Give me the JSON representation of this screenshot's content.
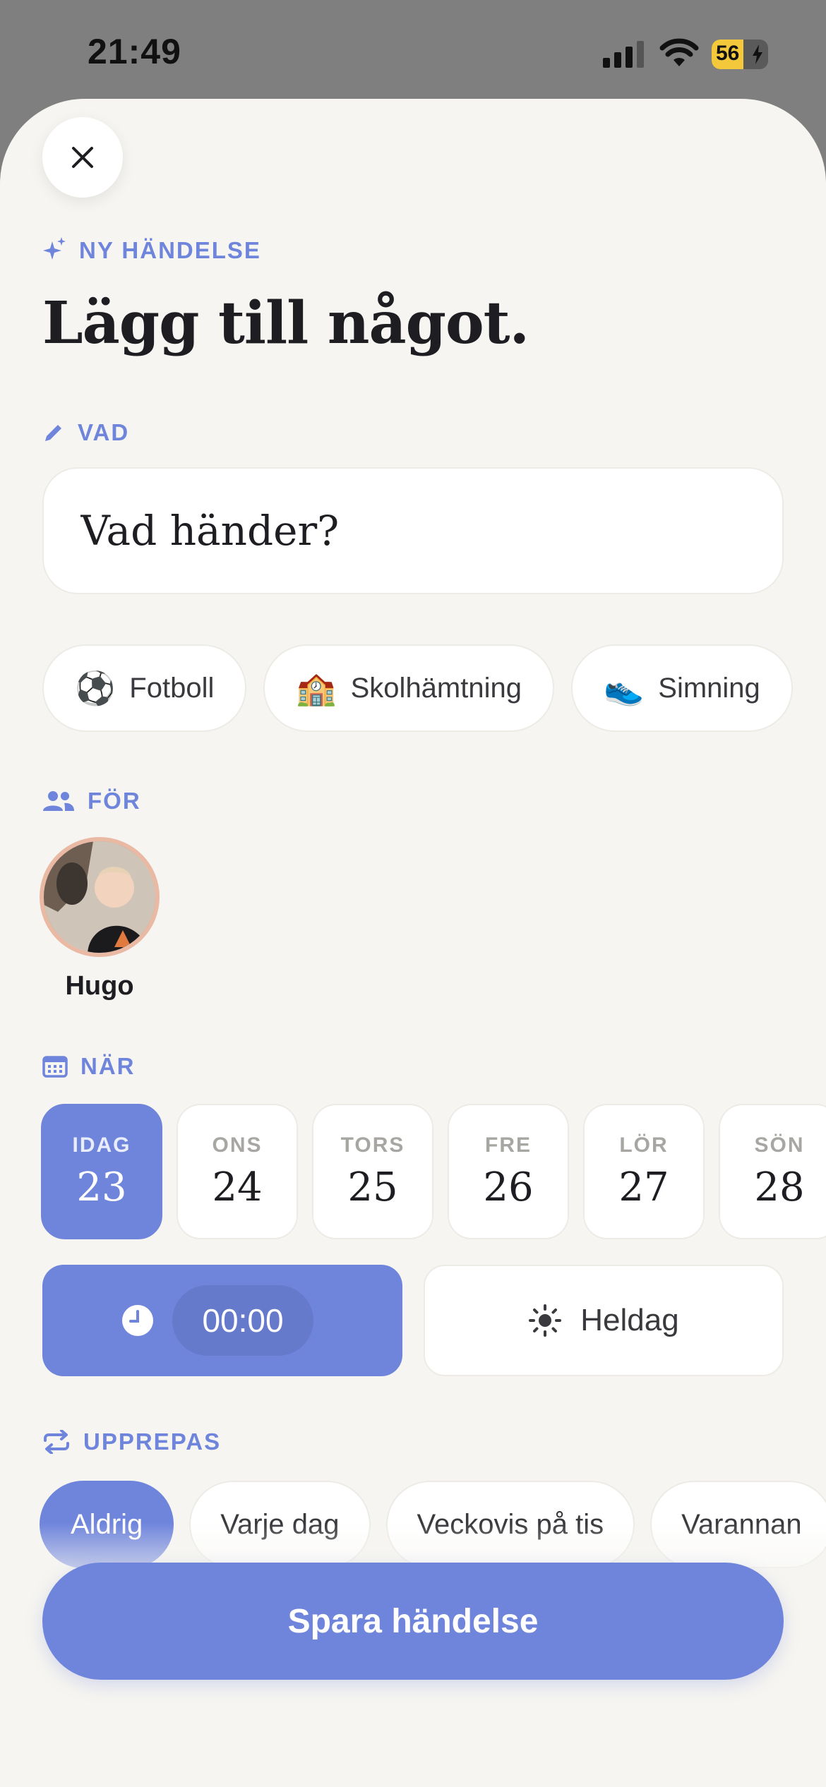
{
  "status_bar": {
    "time": "21:49",
    "battery_level": "56",
    "battery_fraction": 0.56
  },
  "header": {
    "close_icon": "close-icon",
    "eyebrow": "NY HÄNDELSE",
    "title": "Lägg till något."
  },
  "what": {
    "label": "VAD",
    "placeholder": "Vad händer?",
    "suggestions": [
      {
        "emoji": "⚽",
        "label": "Fotboll"
      },
      {
        "emoji": "🏫",
        "label": "Skolhämtning"
      },
      {
        "emoji": "👟",
        "label": "Simning"
      }
    ]
  },
  "for": {
    "label": "FÖR",
    "people": [
      {
        "name": "Hugo"
      }
    ]
  },
  "when": {
    "label": "NÄR",
    "days": [
      {
        "name": "IDAG",
        "num": "23",
        "selected": true
      },
      {
        "name": "ONS",
        "num": "24",
        "selected": false
      },
      {
        "name": "TORS",
        "num": "25",
        "selected": false
      },
      {
        "name": "FRE",
        "num": "26",
        "selected": false
      },
      {
        "name": "LÖR",
        "num": "27",
        "selected": false
      },
      {
        "name": "SÖN",
        "num": "28",
        "selected": false
      }
    ],
    "time_value": "00:00",
    "all_day_label": "Heldag"
  },
  "repeat": {
    "label": "UPPREPAS",
    "options": [
      {
        "label": "Aldrig",
        "selected": true
      },
      {
        "label": "Varje dag",
        "selected": false
      },
      {
        "label": "Veckovis på tis",
        "selected": false
      },
      {
        "label": "Varannan",
        "selected": false
      }
    ]
  },
  "save_button": "Spara händelse",
  "colors": {
    "accent": "#6f85dc",
    "background": "#f6f5f1",
    "text": "#1e1d22"
  }
}
